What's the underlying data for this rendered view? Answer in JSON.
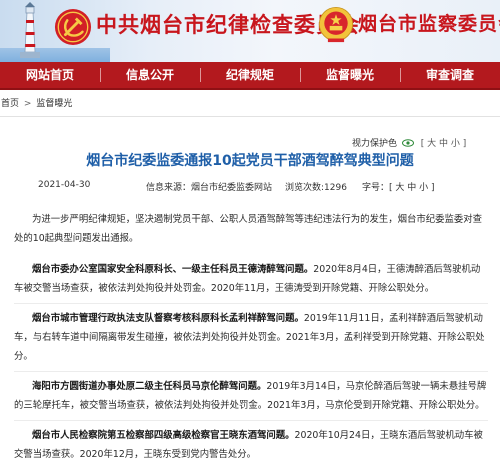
{
  "header": {
    "title_cpc": "中共烟台市纪律检查委员会",
    "title_sup": "烟台市监察委员会",
    "accent_color": "#c8161d",
    "icons": [
      "lighthouse-icon",
      "party-emblem-icon",
      "national-emblem-icon"
    ]
  },
  "nav": {
    "items": [
      {
        "label": "网站首页"
      },
      {
        "label": "信息公开"
      },
      {
        "label": "纪律规矩"
      },
      {
        "label": "监督曝光"
      },
      {
        "label": "审查调查"
      }
    ],
    "background": "#b3191e"
  },
  "breadcrumb": {
    "home": "首页",
    "separator": ">",
    "current": "监督曝光"
  },
  "tools": {
    "view_label": "视力保护色",
    "font_size_label": "[ 大 中 小 ]"
  },
  "article": {
    "title": "烟台市纪委监委通报10起党员干部酒驾醉驾典型问题",
    "date": "2021-04-30",
    "source": "信息来源：烟台市纪委监委网站",
    "views": "浏览次数:1296",
    "font_size": "字号：[ 大 中 小 ]",
    "intro": "为进一步严明纪律规矩，坚决遏制党员干部、公职人员酒驾醉驾等违纪违法行为的发生，烟台市纪委监委对查处的10起典型问题发出通报。",
    "cases": [
      {
        "lead": "烟台市委办公室国家安全科原科长、一级主任科员王德涛醉驾问题。",
        "text": "2020年8月4日，王德涛醉酒后驾驶机动车被交警当场查获，被依法判处拘役并处罚金。2020年11月，王德涛受到开除党籍、开除公职处分。"
      },
      {
        "lead": "烟台市城市管理行政执法支队督察考核科原科长孟利祥醉驾问题。",
        "text": "2019年11月11日，孟利祥醉酒后驾驶机动车，与右转车道中间隔离带发生碰撞，被依法判处拘役并处罚金。2021年3月，孟利祥受到开除党籍、开除公职处分。"
      },
      {
        "lead": "海阳市方圆街道办事处原二级主任科员马京伦醉驾问题。",
        "text": "2019年3月14日，马京伦醉酒后驾驶一辆未悬挂号牌的三轮摩托车，被交警当场查获，被依法判处拘役并处罚金。2021年3月，马京伦受到开除党籍、开除公职处分。"
      },
      {
        "lead": "烟台市人民检察院第五检察部四级高级检察官王晓东酒驾问题。",
        "text": "2020年10月24日，王晓东酒后驾驶机动车被交警当场查获。2020年12月，王晓东受到党内警告处分。"
      }
    ]
  }
}
